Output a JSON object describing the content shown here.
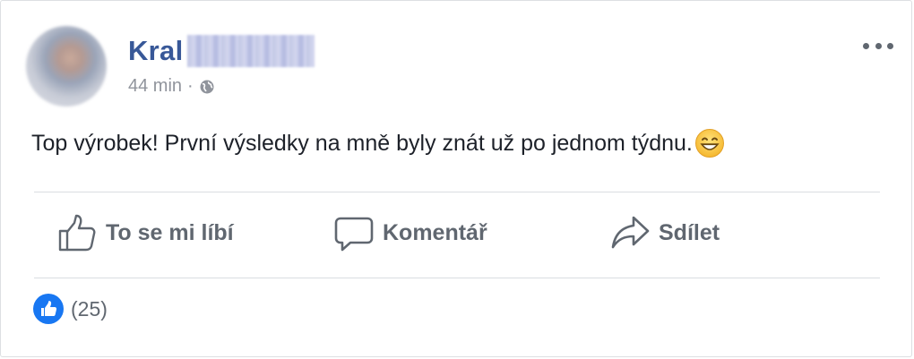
{
  "post": {
    "author_visible": "Kral",
    "time": "44 min",
    "separator": "·",
    "privacy_icon": "globe-icon",
    "text": "Top výrobek! První výsledky na mně byly znát už po jednom týdnu.",
    "emoji": "grinning-face-icon"
  },
  "actions": {
    "like_label": "To se mi líbí",
    "comment_label": "Komentář",
    "share_label": "Sdílet"
  },
  "reactions": {
    "count": "(25)"
  },
  "colors": {
    "author": "#385898",
    "meta": "#90949c",
    "action": "#606770",
    "like_badge": "#1877f2"
  }
}
